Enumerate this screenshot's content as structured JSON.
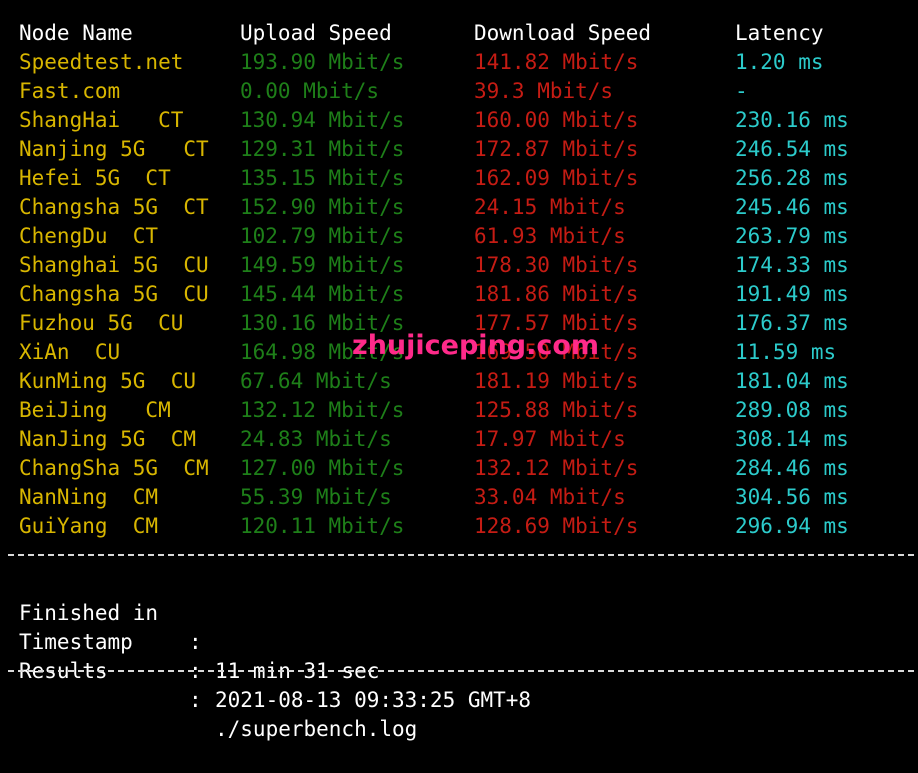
{
  "headers": {
    "node": "Node Name",
    "upload": "Upload Speed",
    "download": "Download Speed",
    "latency": "Latency"
  },
  "rows": [
    {
      "node": "Speedtest.net",
      "upload": "193.90 Mbit/s",
      "download": "141.82 Mbit/s",
      "latency": "1.20 ms"
    },
    {
      "node": "Fast.com",
      "upload": "0.00 Mbit/s",
      "download": "39.3 Mbit/s",
      "latency": "-"
    },
    {
      "node": "ShangHai   CT",
      "upload": "130.94 Mbit/s",
      "download": "160.00 Mbit/s",
      "latency": "230.16 ms"
    },
    {
      "node": "Nanjing 5G   CT",
      "upload": "129.31 Mbit/s",
      "download": "172.87 Mbit/s",
      "latency": "246.54 ms"
    },
    {
      "node": "Hefei 5G  CT",
      "upload": "135.15 Mbit/s",
      "download": "162.09 Mbit/s",
      "latency": "256.28 ms"
    },
    {
      "node": "Changsha 5G  CT",
      "upload": "152.90 Mbit/s",
      "download": "24.15 Mbit/s",
      "latency": "245.46 ms"
    },
    {
      "node": "ChengDu  CT",
      "upload": "102.79 Mbit/s",
      "download": "61.93 Mbit/s",
      "latency": "263.79 ms"
    },
    {
      "node": "Shanghai 5G  CU",
      "upload": "149.59 Mbit/s",
      "download": "178.30 Mbit/s",
      "latency": "174.33 ms"
    },
    {
      "node": "Changsha 5G  CU",
      "upload": "145.44 Mbit/s",
      "download": "181.86 Mbit/s",
      "latency": "191.49 ms"
    },
    {
      "node": "Fuzhou 5G  CU",
      "upload": "130.16 Mbit/s",
      "download": "177.57 Mbit/s",
      "latency": "176.37 ms"
    },
    {
      "node": "XiAn  CU",
      "upload": "164.98 Mbit/s",
      "download": "169.50 Mbit/s",
      "latency": "11.59 ms"
    },
    {
      "node": "KunMing 5G  CU",
      "upload": "67.64 Mbit/s",
      "download": "181.19 Mbit/s",
      "latency": "181.04 ms"
    },
    {
      "node": "BeiJing   CM",
      "upload": "132.12 Mbit/s",
      "download": "125.88 Mbit/s",
      "latency": "289.08 ms"
    },
    {
      "node": "NanJing 5G  CM",
      "upload": "24.83 Mbit/s",
      "download": "17.97 Mbit/s",
      "latency": "308.14 ms"
    },
    {
      "node": "ChangSha 5G  CM",
      "upload": "127.00 Mbit/s",
      "download": "132.12 Mbit/s",
      "latency": "284.46 ms"
    },
    {
      "node": "NanNing  CM",
      "upload": "55.39 Mbit/s",
      "download": "33.04 Mbit/s",
      "latency": "304.56 ms"
    },
    {
      "node": "GuiYang  CM",
      "upload": "120.11 Mbit/s",
      "download": "128.69 Mbit/s",
      "latency": "296.94 ms"
    }
  ],
  "footer": [
    {
      "label": "Finished in",
      "colon": ":",
      "value": "11 min 31 sec"
    },
    {
      "label": "Timestamp",
      "colon": ":",
      "value": "2021-08-13 09:33:25 GMT+8"
    },
    {
      "label": "Results",
      "colon": ":",
      "value": "./superbench.log"
    }
  ],
  "watermark": "zhujiceping.com",
  "colors": {
    "background": "#000000",
    "node_name": "#d8b600",
    "upload": "#1e7f19",
    "download": "#c51c14",
    "latency": "#2ccbcb",
    "header": "#ffffff",
    "watermark": "#ff2a8a"
  }
}
